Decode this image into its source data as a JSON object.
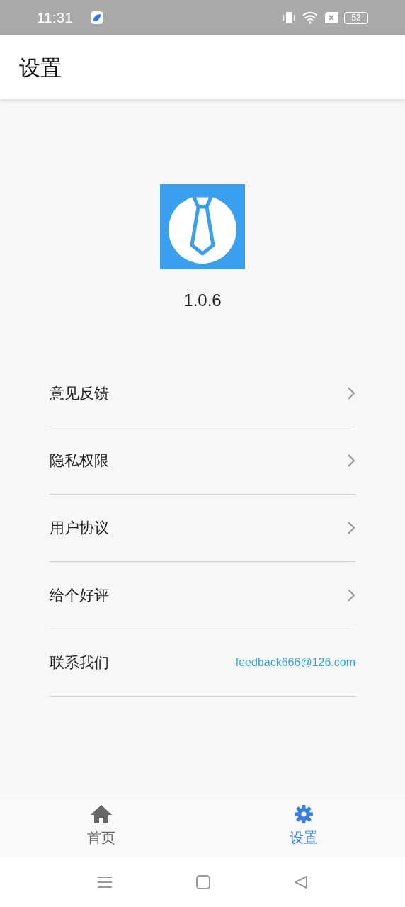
{
  "status_bar": {
    "time": "11:31",
    "battery": "53"
  },
  "header": {
    "title": "设置"
  },
  "app": {
    "version": "1.0.6"
  },
  "menu": [
    {
      "kind": "link",
      "label": "意见反馈"
    },
    {
      "kind": "link",
      "label": "隐私权限"
    },
    {
      "kind": "link",
      "label": "用户协议"
    },
    {
      "kind": "link",
      "label": "给个好评"
    },
    {
      "kind": "contact",
      "label": "联系我们",
      "value": "feedback666@126.com"
    }
  ],
  "tabs": [
    {
      "kind": "home",
      "label": "首页",
      "selected": false
    },
    {
      "kind": "settings",
      "label": "设置",
      "selected": true
    }
  ]
}
